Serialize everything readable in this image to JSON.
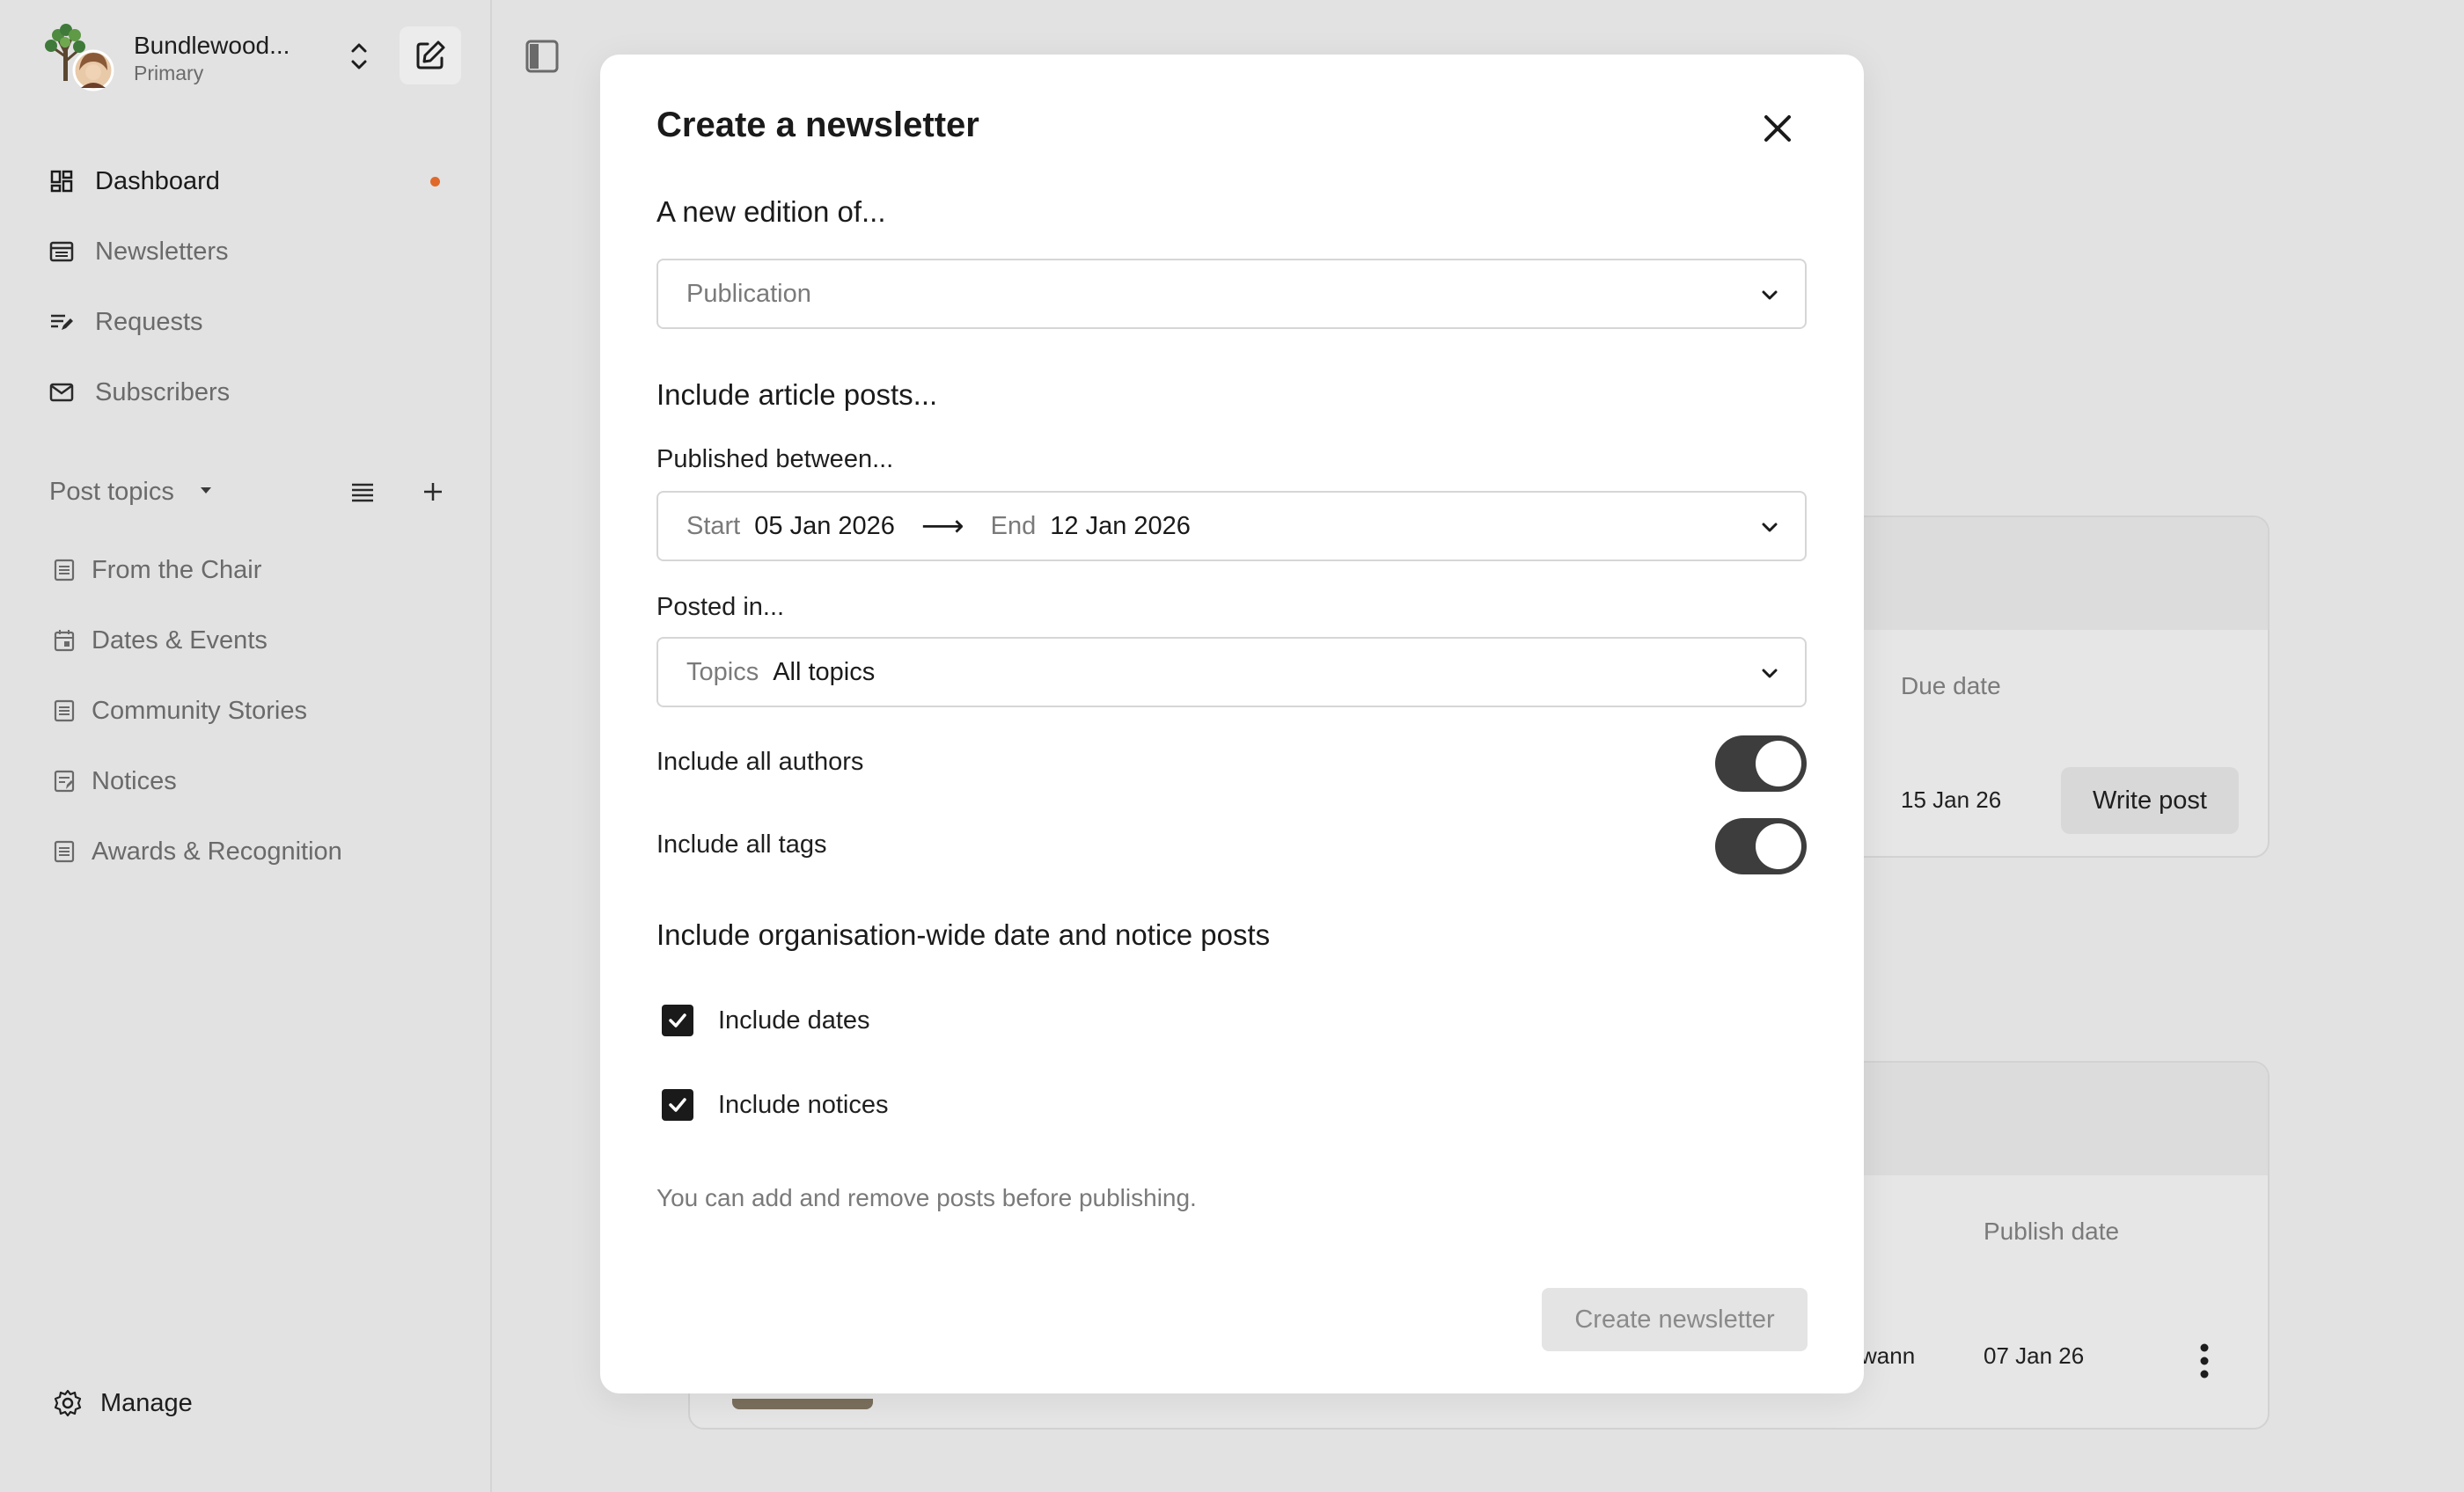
{
  "org": {
    "name": "Bundlewood...",
    "role": "Primary"
  },
  "nav": [
    {
      "label": "Dashboard",
      "icon": "dashboard-icon",
      "active": true,
      "badge": true
    },
    {
      "label": "Newsletters",
      "icon": "newsletter-icon"
    },
    {
      "label": "Requests",
      "icon": "requests-icon"
    },
    {
      "label": "Subscribers",
      "icon": "mail-icon"
    }
  ],
  "topics": {
    "title": "Post topics",
    "items": [
      {
        "label": "From the Chair",
        "icon": "document-icon"
      },
      {
        "label": "Dates & Events",
        "icon": "calendar-icon"
      },
      {
        "label": "Community Stories",
        "icon": "document-icon"
      },
      {
        "label": "Notices",
        "icon": "notice-icon"
      },
      {
        "label": "Awards & Recognition",
        "icon": "document-icon"
      }
    ]
  },
  "manage": {
    "label": "Manage"
  },
  "background": {
    "card1": {
      "due_header": "Due date",
      "due_value": "15 Jan 26",
      "write_label": "Write post"
    },
    "card2": {
      "author_fragment": "wann",
      "publish_header": "Publish date",
      "publish_value": "07 Jan 26"
    }
  },
  "modal": {
    "title": "Create a newsletter",
    "edition_heading": "A new edition of...",
    "publication_placeholder": "Publication",
    "articles_heading": "Include article posts...",
    "published_label": "Published between...",
    "date_range": {
      "start_label": "Start",
      "start_value": "05 Jan 2026",
      "arrow": "⟶",
      "end_label": "End",
      "end_value": "12 Jan 2026"
    },
    "posted_label": "Posted in...",
    "topics_select": {
      "label": "Topics",
      "value": "All topics"
    },
    "toggles": [
      {
        "label": "Include all authors",
        "on": true
      },
      {
        "label": "Include all tags",
        "on": true
      }
    ],
    "org_heading": "Include organisation-wide date and notice posts",
    "checkboxes": [
      {
        "label": "Include dates",
        "checked": true
      },
      {
        "label": "Include notices",
        "checked": true
      }
    ],
    "note": "You can add and remove posts before publishing.",
    "create_label": "Create newsletter"
  },
  "colors": {
    "accent_dot": "#e0692a",
    "toggle_on": "#3d3d3d",
    "checkbox": "#1a1a1a"
  }
}
